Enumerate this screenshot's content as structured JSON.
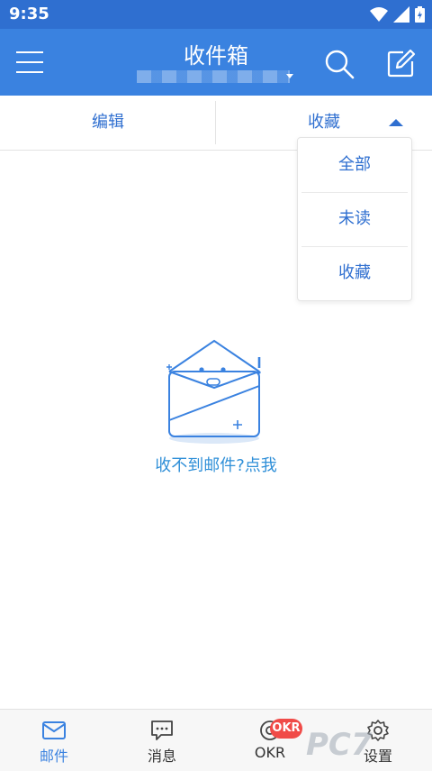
{
  "statusbar": {
    "time": "9:35",
    "icons": [
      "wifi-icon",
      "signal-icon",
      "battery-icon"
    ]
  },
  "header": {
    "title": "收件箱",
    "menu_icon": "menu-icon",
    "search_icon": "search-icon",
    "compose_icon": "compose-icon"
  },
  "tabs": {
    "edit": "编辑",
    "filter": "收藏"
  },
  "dropdown": {
    "items": [
      "全部",
      "未读",
      "收藏"
    ]
  },
  "empty_state": {
    "link": "收不到邮件?点我",
    "icon": "envelope-illustration"
  },
  "bottom_nav": {
    "items": [
      {
        "label": "邮件",
        "icon": "mail-icon"
      },
      {
        "label": "消息",
        "icon": "chat-icon"
      },
      {
        "label": "OKR",
        "icon": "okr-icon",
        "badge": "OKR"
      },
      {
        "label": "设置",
        "icon": "gear-icon"
      }
    ],
    "active_color": "#3a82e0"
  },
  "watermark": "PC7"
}
